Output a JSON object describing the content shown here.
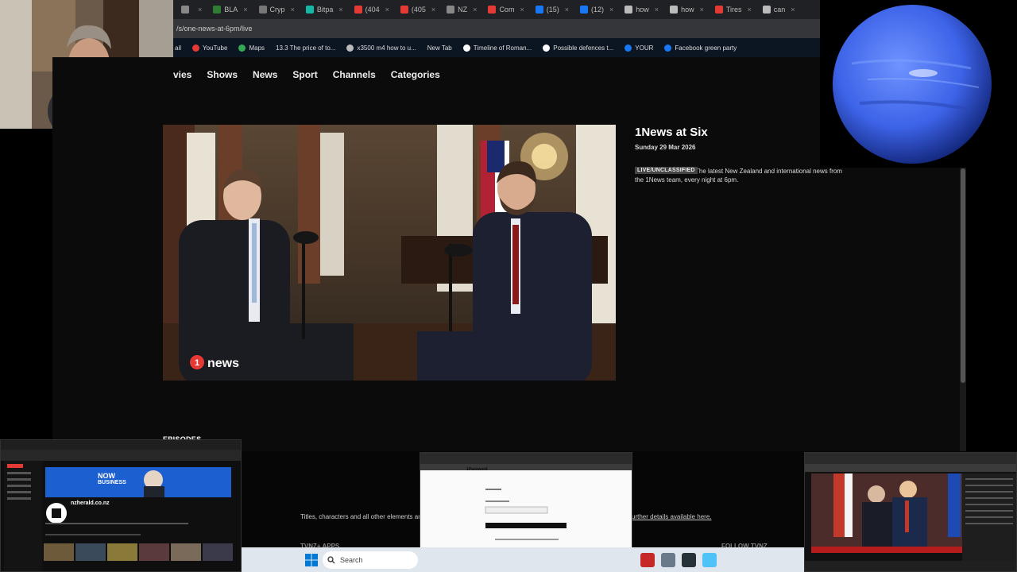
{
  "browser": {
    "tabs": [
      {
        "label": "",
        "color": "#888"
      },
      {
        "label": "BLA",
        "color": "#2e7d32"
      },
      {
        "label": "Cryp",
        "color": "#777"
      },
      {
        "label": "Bitpa",
        "color": "#14b8a6"
      },
      {
        "label": "(404",
        "color": "#e53935"
      },
      {
        "label": "(405",
        "color": "#e53935"
      },
      {
        "label": "NZ",
        "color": "#888"
      },
      {
        "label": "Com",
        "color": "#e53935"
      },
      {
        "label": "(15)",
        "color": "#1877f2"
      },
      {
        "label": "(12)",
        "color": "#1877f2"
      },
      {
        "label": "how",
        "color": "#bbb"
      },
      {
        "label": "how",
        "color": "#bbb"
      },
      {
        "label": "Tires",
        "color": "#e53935"
      },
      {
        "label": "can",
        "color": "#bbb"
      }
    ],
    "address": "/s/one-news-at-6pm/live",
    "bookmarks": [
      {
        "label": "ail",
        "color": ""
      },
      {
        "label": "YouTube",
        "color": "#e53935"
      },
      {
        "label": "Maps",
        "color": "#34a853"
      },
      {
        "label": "13.3 The price of to...",
        "color": ""
      },
      {
        "label": "x3500 m4 how to u...",
        "color": "#bbb"
      },
      {
        "label": "New Tab",
        "color": ""
      },
      {
        "label": "Timeline of Roman...",
        "color": "#fff"
      },
      {
        "label": "Possible defences t...",
        "color": "#fff"
      },
      {
        "label": "YOUR",
        "color": "#1877f2"
      },
      {
        "label": "Facebook green party",
        "color": "#1877f2"
      }
    ]
  },
  "nav": {
    "items": [
      "vies",
      "Shows",
      "News",
      "Sport",
      "Channels",
      "Categories"
    ]
  },
  "show": {
    "title": "1News at Six",
    "date": "Sunday 29 Mar 2026",
    "badge": "LIVE/UNCLASSIFIED",
    "description": "The latest New Zealand and international news from the 1News team, every night at 6pm."
  },
  "video": {
    "logo_text": "news",
    "logo_number": "1"
  },
  "episodes_heading": "EPISODES",
  "footer": {
    "credits_text": "Titles, characters and all other elements are",
    "credits_link": "urther details available here.",
    "apps_heading": "TVNZ+ APPS",
    "follow_heading": "FOLLOW TVNZ"
  },
  "thumbnails": {
    "left_banner_line1": "NOW",
    "left_banner_line2": "BUSINESS",
    "left_channel": "nzherald.co.nz",
    "mid_header": "1Password"
  },
  "taskbar": {
    "search_label": "Search"
  },
  "colors": {
    "page_bg": "#0b0b0b",
    "planet_blue": "#3d63e8",
    "taskbar_bg": "#dfe6ee"
  }
}
